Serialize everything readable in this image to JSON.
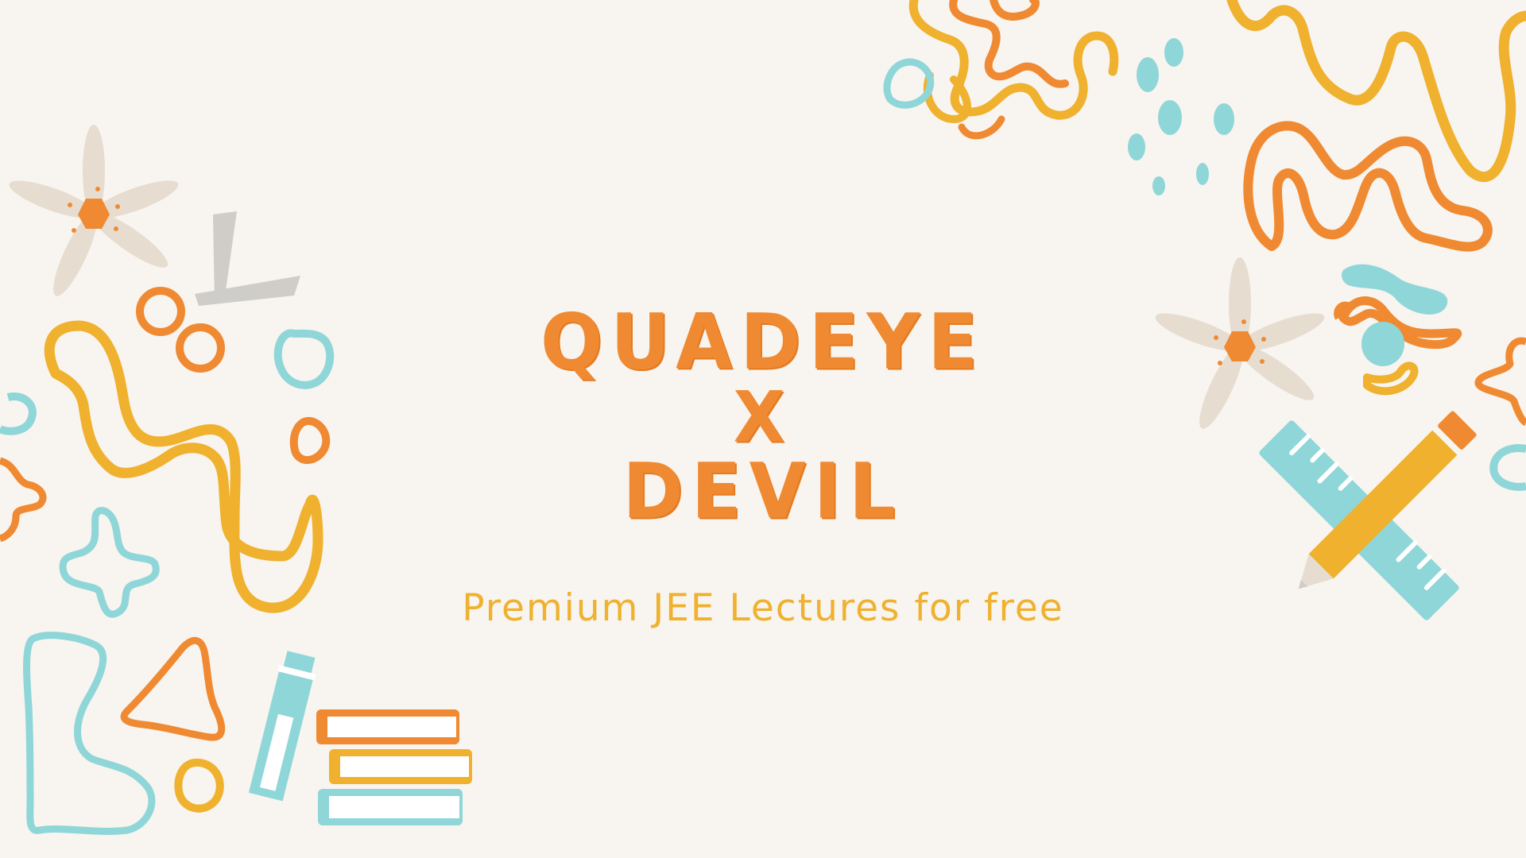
{
  "title": {
    "line1": "QUADEYE",
    "line2": "X",
    "line3": "DEVIL"
  },
  "subtitle": "Premium JEE Lectures for free",
  "colors": {
    "background": "#f8f4ef",
    "orange": "#f08a32",
    "yellow": "#efb12e",
    "teal": "#8fd6d9",
    "beige": "#e6ddd0",
    "gray": "#cfcdc9"
  },
  "icons": [
    "flower-icon",
    "scissors-icon",
    "pencil-icon",
    "ruler-icon",
    "glue-stick-icon",
    "books-icon"
  ]
}
